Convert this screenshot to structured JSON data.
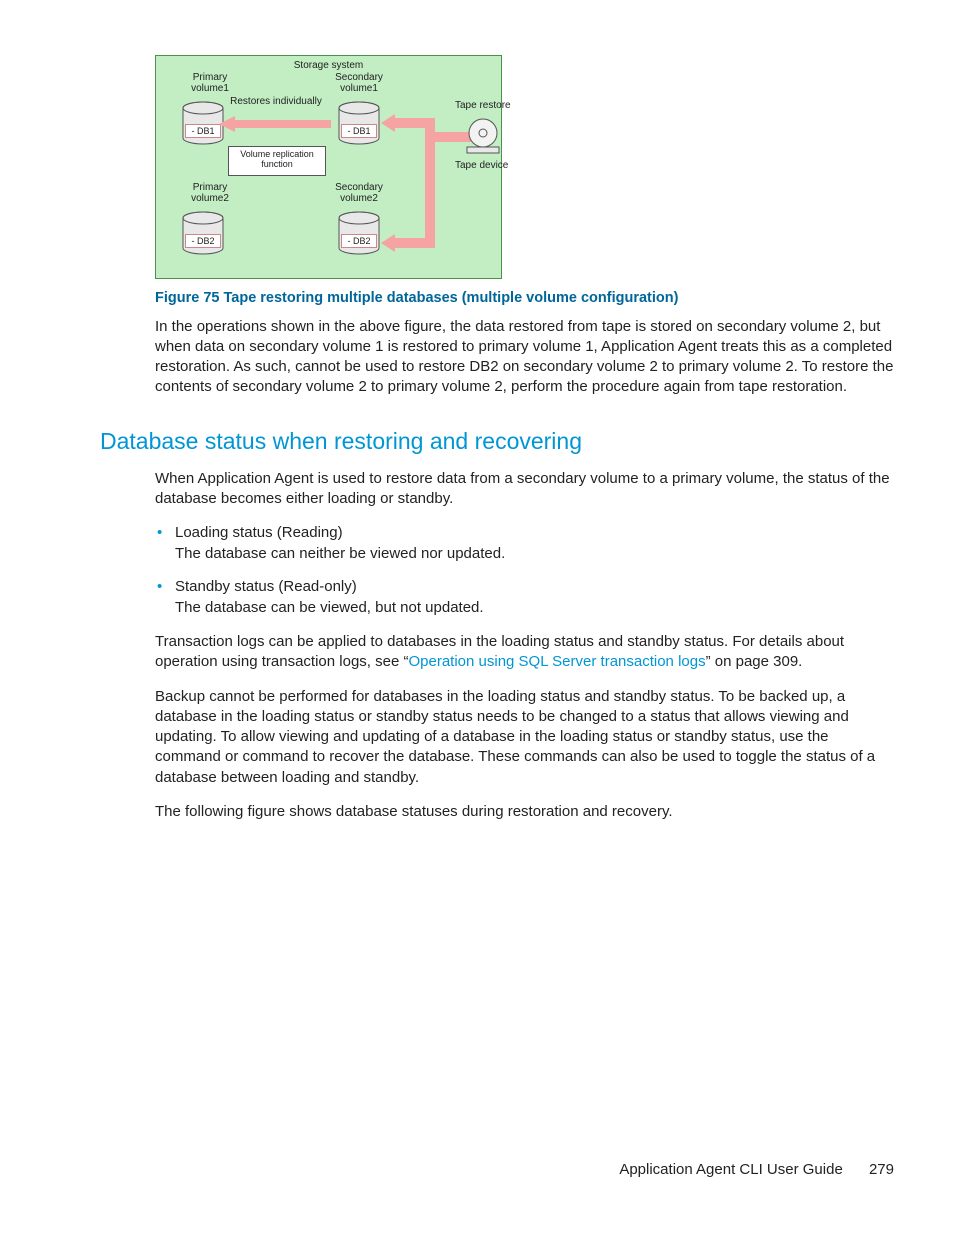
{
  "diagram": {
    "storage_system": "Storage system",
    "primary1": "Primary\nvolume1",
    "secondary1": "Secondary\nvolume1",
    "primary2": "Primary\nvolume2",
    "secondary2": "Secondary\nvolume2",
    "restores_individually": "Restores individually",
    "volume_replication": "Volume replication\nfunction",
    "tape_restore": "Tape restore",
    "tape_device": "Tape device",
    "db1": "- DB1",
    "db2": "- DB2"
  },
  "caption": "Figure 75 Tape restoring multiple databases (multiple volume configuration)",
  "para1a": "In the operations shown in the above figure, the data restored from tape is stored on secondary volume 2, but when data on secondary volume 1 is restored to primary volume 1, Application Agent treats this as a completed restoration. As such, ",
  "para1b": " cannot be used to restore DB2 on secondary volume 2 to primary volume 2. To restore the contents of secondary volume 2 to primary volume 2, perform the procedure again from tape restoration.",
  "section_title": "Database status when restoring and recovering",
  "para2": "When Application Agent is used to restore data from a secondary volume to a primary volume, the status of the database becomes either loading or standby.",
  "bullets": [
    {
      "title": "Loading status (Reading)",
      "desc": "The database can neither be viewed nor updated."
    },
    {
      "title": "Standby status (Read-only)",
      "desc": "The database can be viewed, but not updated."
    }
  ],
  "para3a": "Transaction logs can be applied to databases in the loading status and standby status. For details about operation using transaction logs, see “",
  "para3link": "Operation using SQL Server transaction logs",
  "para3b": "” on page 309.",
  "para4a": "Backup cannot be performed for databases in the loading status and standby status. To be backed up, a database in the loading status or standby status needs to be changed to a status that allows viewing and updating. To allow viewing and updating of a database in the loading status or standby status, use the ",
  "para4b": " command or ",
  "para4c": " command to recover the database. These commands can also be used to toggle the status of a database between loading and standby.",
  "para5": "The following figure shows database statuses during restoration and recovery.",
  "footer": {
    "title": "Application Agent CLI User Guide",
    "page": "279"
  }
}
